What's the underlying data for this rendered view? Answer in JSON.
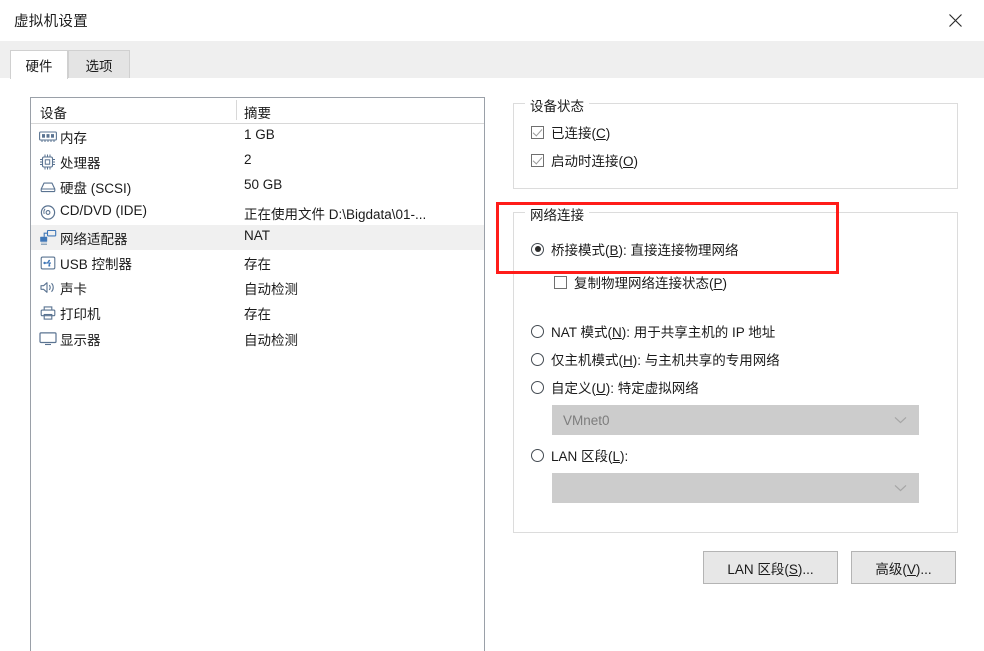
{
  "window": {
    "title": "虚拟机设置",
    "close_label": "×"
  },
  "tabs": [
    {
      "label": "硬件",
      "active": true
    },
    {
      "label": "选项",
      "active": false
    }
  ],
  "device_list": {
    "columns": [
      "设备",
      "摘要"
    ],
    "rows": [
      {
        "icon": "memory-icon",
        "name": "内存",
        "summary": "1 GB",
        "selected": false
      },
      {
        "icon": "processor-icon",
        "name": "处理器",
        "summary": "2",
        "selected": false
      },
      {
        "icon": "harddisk-icon",
        "name": "硬盘 (SCSI)",
        "summary": "50 GB",
        "selected": false
      },
      {
        "icon": "cddvd-icon",
        "name": "CD/DVD (IDE)",
        "summary": "正在使用文件 D:\\Bigdata\\01-...",
        "selected": false
      },
      {
        "icon": "network-adapter-icon",
        "name": "网络适配器",
        "summary": "NAT",
        "selected": true
      },
      {
        "icon": "usb-icon",
        "name": "USB 控制器",
        "summary": "存在",
        "selected": false
      },
      {
        "icon": "sound-card-icon",
        "name": "声卡",
        "summary": "自动检测",
        "selected": false
      },
      {
        "icon": "printer-icon",
        "name": "打印机",
        "summary": "存在",
        "selected": false
      },
      {
        "icon": "display-icon",
        "name": "显示器",
        "summary": "自动检测",
        "selected": false
      }
    ]
  },
  "device_status": {
    "legend": "设备状态",
    "options": [
      {
        "label_pre": "已连接(",
        "accel": "C",
        "label_post": ")",
        "checked": true
      },
      {
        "label_pre": "启动时连接(",
        "accel": "O",
        "label_post": ")",
        "checked": true
      }
    ]
  },
  "network_connection": {
    "legend": "网络连接",
    "bridged": {
      "label_pre": "桥接模式(",
      "accel": "B",
      "label_post": "): 直接连接物理网络",
      "selected": true
    },
    "replicate": {
      "label_pre": "复制物理网络连接状态(",
      "accel": "P",
      "label_post": ")",
      "checked": false
    },
    "nat": {
      "label_pre": "NAT 模式(",
      "accel": "N",
      "label_post": "): 用于共享主机的 IP 地址",
      "selected": false
    },
    "host_only": {
      "label_pre": "仅主机模式(",
      "accel": "H",
      "label_post": "): 与主机共享的专用网络",
      "selected": false
    },
    "custom": {
      "label_pre": "自定义(",
      "accel": "U",
      "label_post": "): 特定虚拟网络",
      "selected": false,
      "combo_value": "VMnet0"
    },
    "lan_segment": {
      "label_pre": "LAN 区段(",
      "accel": "L",
      "label_post": "):",
      "selected": false,
      "combo_value": ""
    }
  },
  "buttons": {
    "lan_segments": {
      "label_pre": "LAN 区段(",
      "accel": "S",
      "label_post": ")..."
    },
    "advanced": {
      "label_pre": "高级(",
      "accel": "V",
      "label_post": ")..."
    }
  },
  "annotation": {
    "color": "#ff1c19",
    "note": "highlight around bridged-mode option"
  }
}
